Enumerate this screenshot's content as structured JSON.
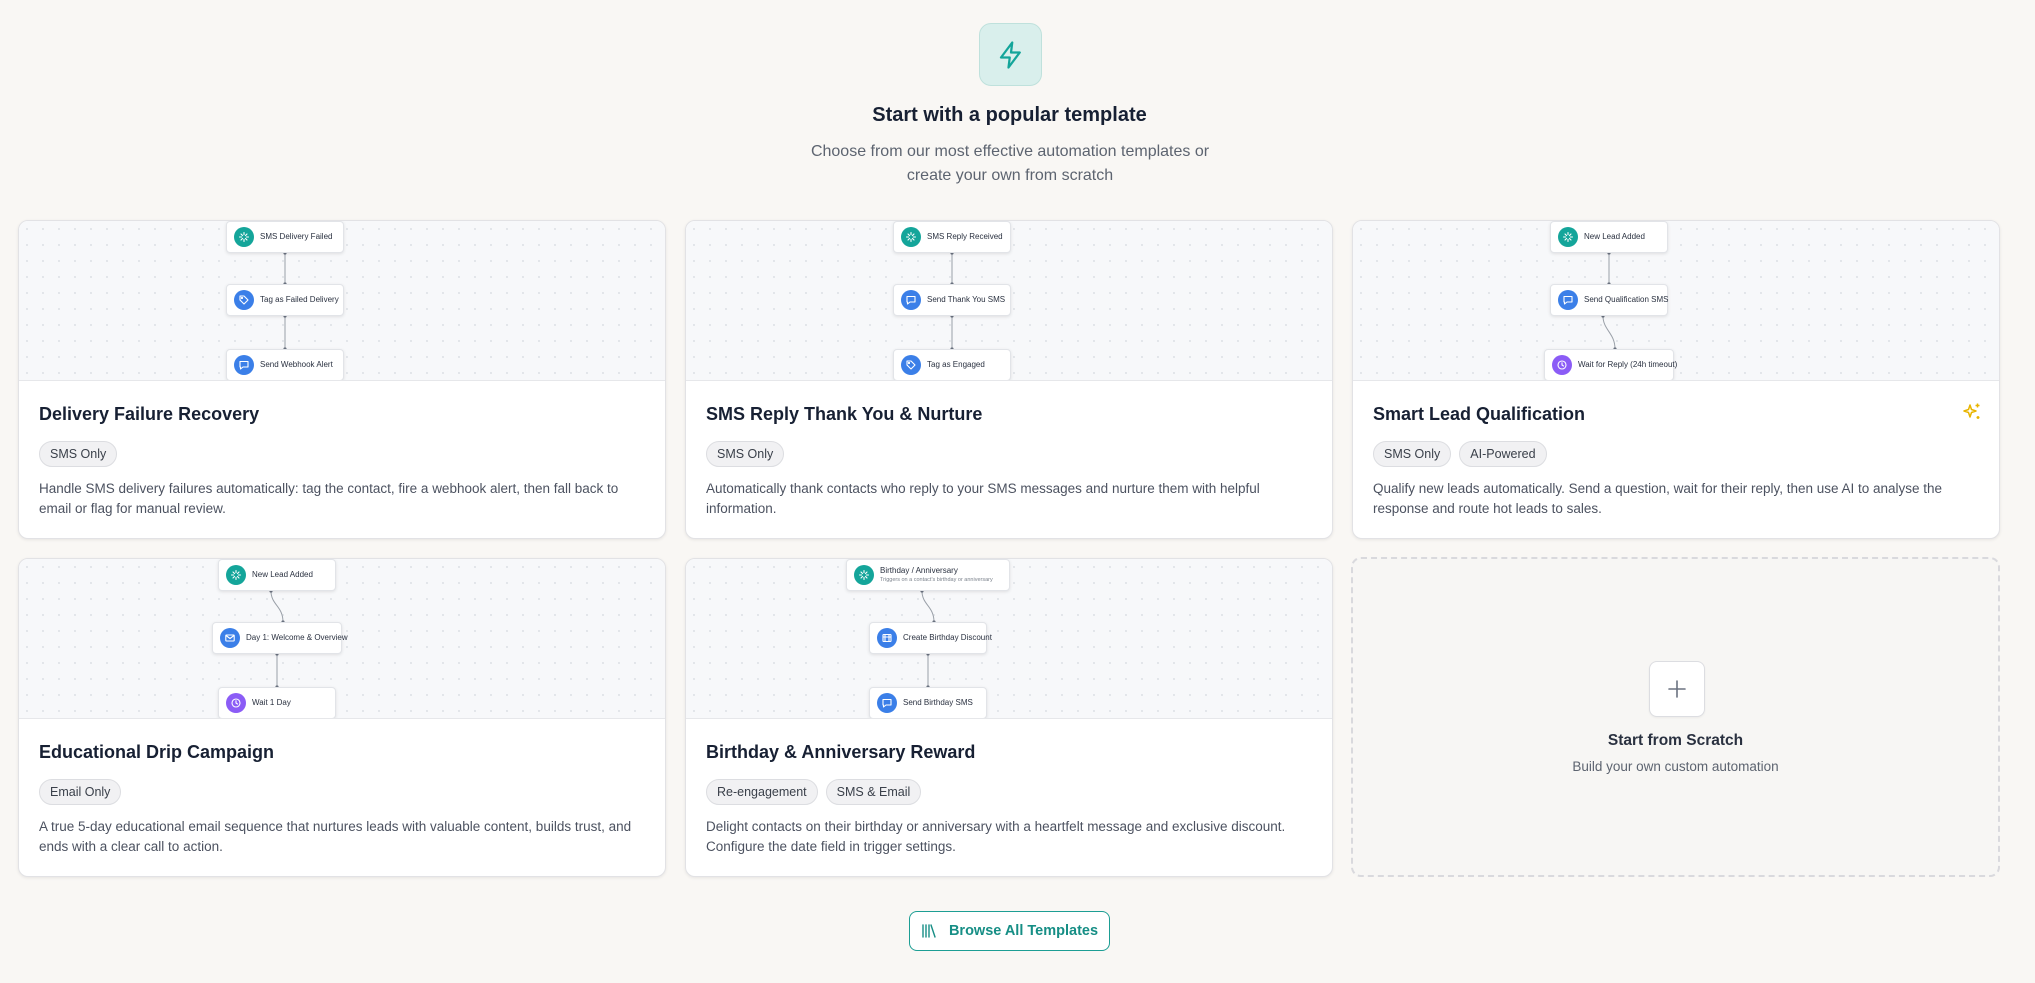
{
  "header": {
    "icon": "lightning-bolt-icon",
    "title": "Start with a popular template",
    "subtitle": "Choose from our most effective automation templates or create your own from scratch"
  },
  "colors": {
    "accent": "#14a59a",
    "node_blue": "#3b7fe8",
    "node_purple": "#8b5cf6",
    "ai_sparkle": "#e8b400"
  },
  "templates": [
    {
      "title": "Delivery Failure Recovery",
      "badges": [
        "SMS Only"
      ],
      "description": "Handle SMS delivery failures automatically: tag the contact, fire a webhook alert, then fall back to email or flag for manual review.",
      "ai": false,
      "nodes": [
        {
          "label": "SMS Delivery Failed",
          "icon": "trigger-icon"
        },
        {
          "label": "Tag as Failed Delivery",
          "icon": "tag-icon"
        },
        {
          "label": "Send Webhook Alert",
          "icon": "message-icon"
        }
      ]
    },
    {
      "title": "SMS Reply Thank You & Nurture",
      "badges": [
        "SMS Only"
      ],
      "description": "Automatically thank contacts who reply to your SMS messages and nurture them with helpful information.",
      "ai": false,
      "nodes": [
        {
          "label": "SMS Reply Received",
          "icon": "trigger-icon"
        },
        {
          "label": "Send Thank You SMS",
          "icon": "message-icon"
        },
        {
          "label": "Tag as Engaged",
          "icon": "tag-icon"
        }
      ]
    },
    {
      "title": "Smart Lead Qualification",
      "badges": [
        "SMS Only",
        "AI-Powered"
      ],
      "description": "Qualify new leads automatically. Send a question, wait for their reply, then use AI to analyse the response and route hot leads to sales.",
      "ai": true,
      "nodes": [
        {
          "label": "New Lead Added",
          "icon": "trigger-icon"
        },
        {
          "label": "Send Qualification SMS",
          "icon": "message-icon"
        },
        {
          "label": "Wait for Reply (24h timeout)",
          "icon": "clock-icon"
        }
      ]
    },
    {
      "title": "Educational Drip Campaign",
      "badges": [
        "Email Only"
      ],
      "description": "A true 5-day educational email sequence that nurtures leads with valuable content, builds trust, and ends with a clear call to action.",
      "ai": false,
      "nodes": [
        {
          "label": "New Lead Added",
          "icon": "trigger-icon"
        },
        {
          "label": "Day 1: Welcome & Overview",
          "icon": "mail-icon"
        },
        {
          "label": "Wait 1 Day",
          "icon": "clock-icon"
        }
      ]
    },
    {
      "title": "Birthday & Anniversary Reward",
      "badges": [
        "Re-engagement",
        "SMS & Email"
      ],
      "description": "Delight contacts on their birthday or anniversary with a heartfelt message and exclusive discount. Configure the date field in trigger settings.",
      "ai": false,
      "nodes": [
        {
          "label": "Birthday / Anniversary",
          "sublabel": "Triggers on a contact's birthday or anniversary",
          "icon": "trigger-icon"
        },
        {
          "label": "Create Birthday Discount",
          "icon": "discount-icon"
        },
        {
          "label": "Send Birthday SMS",
          "icon": "message-icon"
        }
      ]
    }
  ],
  "scratch": {
    "title": "Start from Scratch",
    "subtitle": "Build your own custom automation",
    "icon": "plus-icon"
  },
  "browse": {
    "label": "Browse All Templates",
    "icon": "library-icon"
  }
}
